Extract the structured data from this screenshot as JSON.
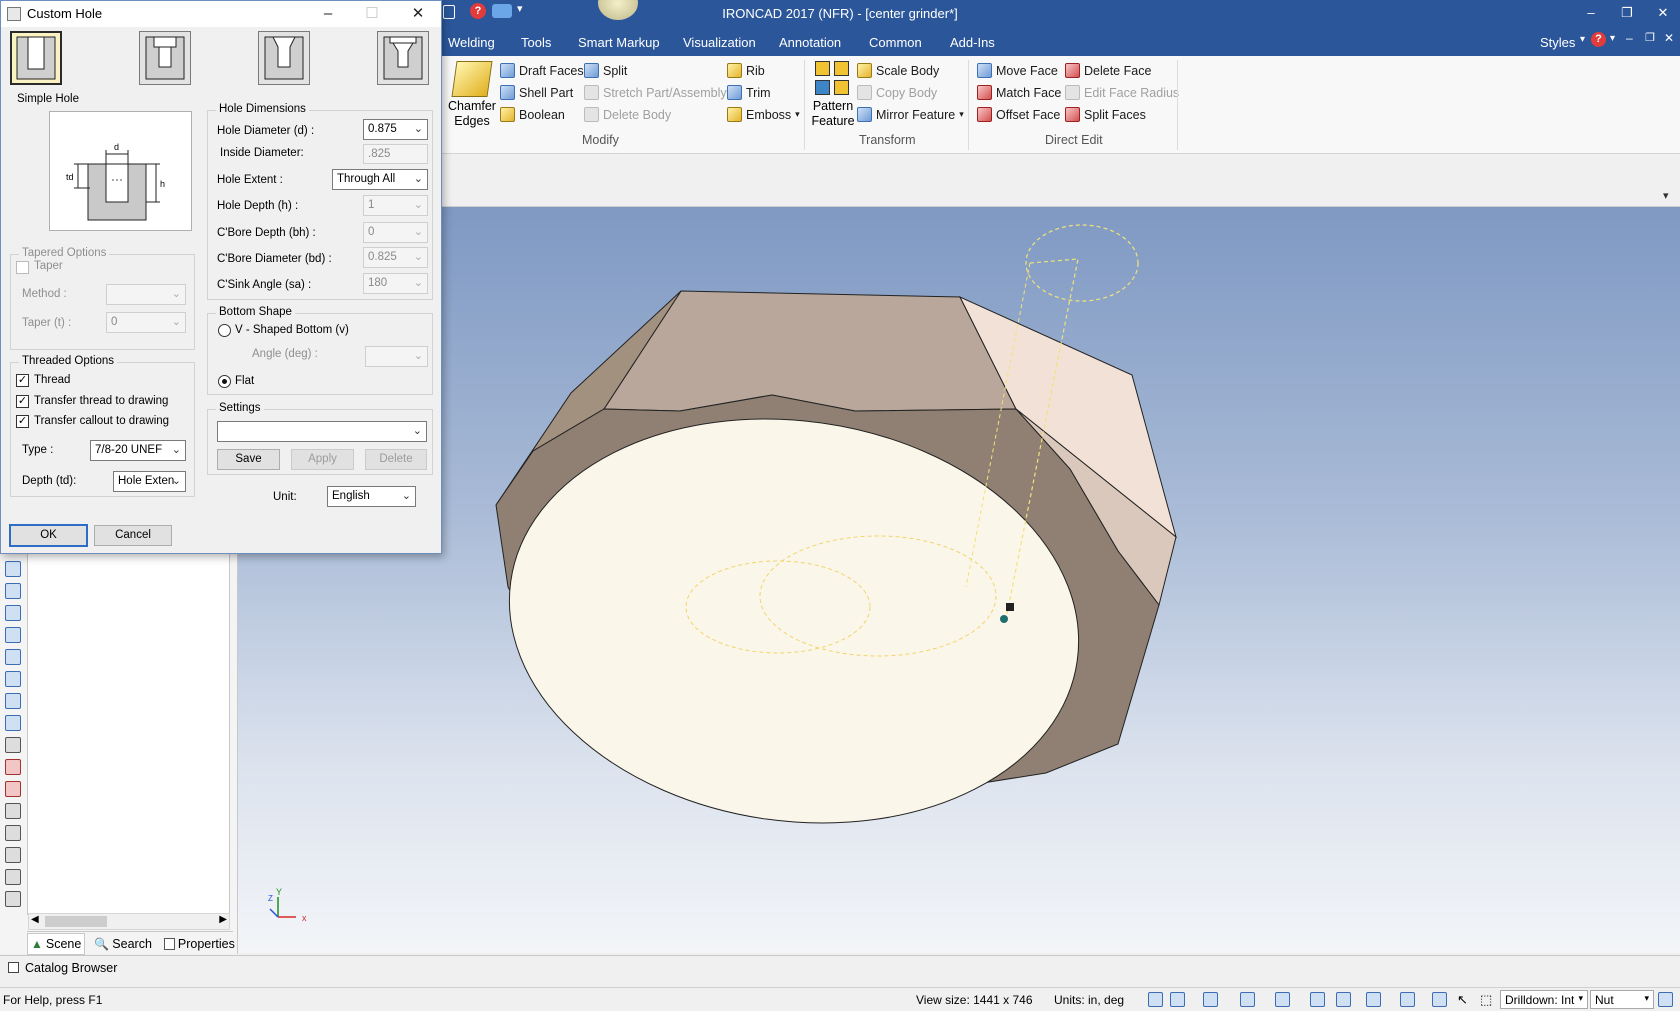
{
  "app": {
    "title": "IRONCAD 2017 (NFR) - [center grinder*]",
    "tabs": [
      "Welding",
      "Tools",
      "Smart Markup",
      "Visualization",
      "Annotation",
      "Common",
      "Add-Ins"
    ],
    "styles_label": "Styles"
  },
  "ribbon": {
    "modify": {
      "group_label": "Modify",
      "chamfer": "Chamfer\nEdges",
      "draft_faces": "Draft Faces",
      "shell_part": "Shell Part",
      "boolean": "Boolean",
      "split": "Split",
      "stretch": "Stretch Part/Assembly",
      "delete_body": "Delete Body",
      "rib": "Rib",
      "trim": "Trim",
      "emboss": "Emboss"
    },
    "transform": {
      "group_label": "Transform",
      "pattern_feature": "Pattern\nFeature",
      "scale_body": "Scale Body",
      "copy_body": "Copy Body",
      "mirror_feature": "Mirror Feature"
    },
    "direct_edit": {
      "group_label": "Direct Edit",
      "move_face": "Move Face",
      "match_face": "Match Face",
      "offset_face": "Offset Face",
      "delete_face": "Delete Face",
      "edit_face_radius": "Edit Face Radius",
      "split_faces": "Split Faces"
    }
  },
  "dialog": {
    "title": "Custom Hole",
    "simple_hole_label": "Simple Hole",
    "tapered": {
      "legend": "Tapered Options",
      "taper_label": "Taper",
      "method_label": "Method :",
      "method_value": "",
      "taper_t_label": "Taper (t) :",
      "taper_t_value": "0"
    },
    "threaded": {
      "legend": "Threaded Options",
      "thread_label": "Thread",
      "transfer_thread_label": "Transfer thread to drawing",
      "transfer_callout_label": "Transfer callout to drawing",
      "type_label": "Type :",
      "type_value": "7/8-20 UNEF",
      "depth_label": "Depth (td):",
      "depth_value": "Hole Exten"
    },
    "dimensions": {
      "legend": "Hole Dimensions",
      "hole_diameter_label": "Hole Diameter (d) :",
      "hole_diameter_value": "0.875",
      "inside_diameter_label": "Inside Diameter:",
      "inside_diameter_value": ".825",
      "hole_extent_label": "Hole Extent :",
      "hole_extent_value": "Through All",
      "hole_depth_label": "Hole Depth (h) :",
      "hole_depth_value": "1",
      "cbore_depth_label": "C'Bore Depth (bh) :",
      "cbore_depth_value": "0",
      "cbore_diameter_label": "C'Bore Diameter (bd) :",
      "cbore_diameter_value": "0.825",
      "csink_angle_label": "C'Sink Angle (sa) :",
      "csink_angle_value": "180"
    },
    "bottom": {
      "legend": "Bottom Shape",
      "vshape_label": "V - Shaped Bottom (v)",
      "angle_label": "Angle (deg) :",
      "flat_label": "Flat"
    },
    "settings": {
      "legend": "Settings",
      "value": "",
      "save": "Save",
      "apply": "Apply",
      "delete": "Delete"
    },
    "unit_label": "Unit:",
    "unit_value": "English",
    "ok": "OK",
    "cancel": "Cancel"
  },
  "panel": {
    "tabs": [
      "Scene",
      "Search",
      "Properties"
    ],
    "catalog_browser": "Catalog Browser"
  },
  "status": {
    "help": "For Help, press F1",
    "view_size": "View size: 1441 x  746",
    "units": "Units: in, deg",
    "drilldown": "Drilldown: Int",
    "nut": "Nut"
  }
}
